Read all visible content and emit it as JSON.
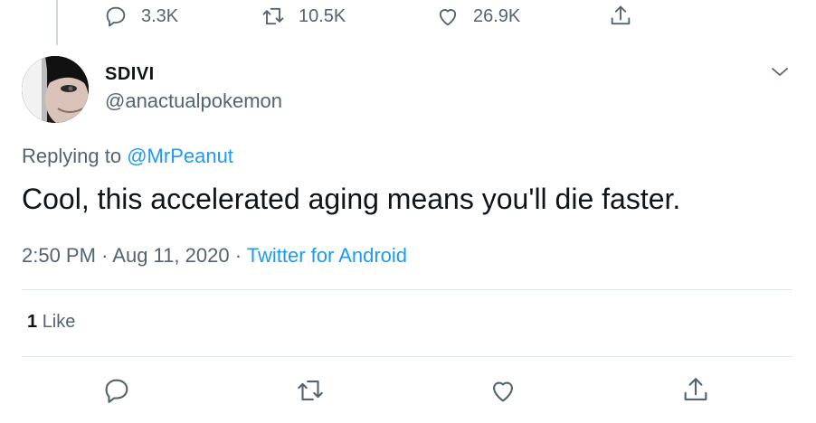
{
  "previous_tweet": {
    "replies": "3.3K",
    "retweets": "10.5K",
    "likes": "26.9K"
  },
  "tweet": {
    "display_name": "SDIVI",
    "handle": "@anactualpokemon",
    "replying_prefix": "Replying to",
    "replying_to": "@MrPeanut",
    "text": "Cool, this accelerated aging means you'll die faster.",
    "time": "2:50 PM",
    "date": "Aug 11, 2020",
    "separator": "·",
    "source": "Twitter for Android",
    "like_count": "1",
    "like_label": "Like"
  },
  "colors": {
    "accent": "#1d9bf0",
    "secondary_text": "#536471",
    "primary_text": "#0f1419",
    "divider": "#e1e8ed"
  },
  "icons": [
    "reply-icon",
    "retweet-icon",
    "like-icon",
    "share-icon",
    "chevron-down-icon"
  ]
}
